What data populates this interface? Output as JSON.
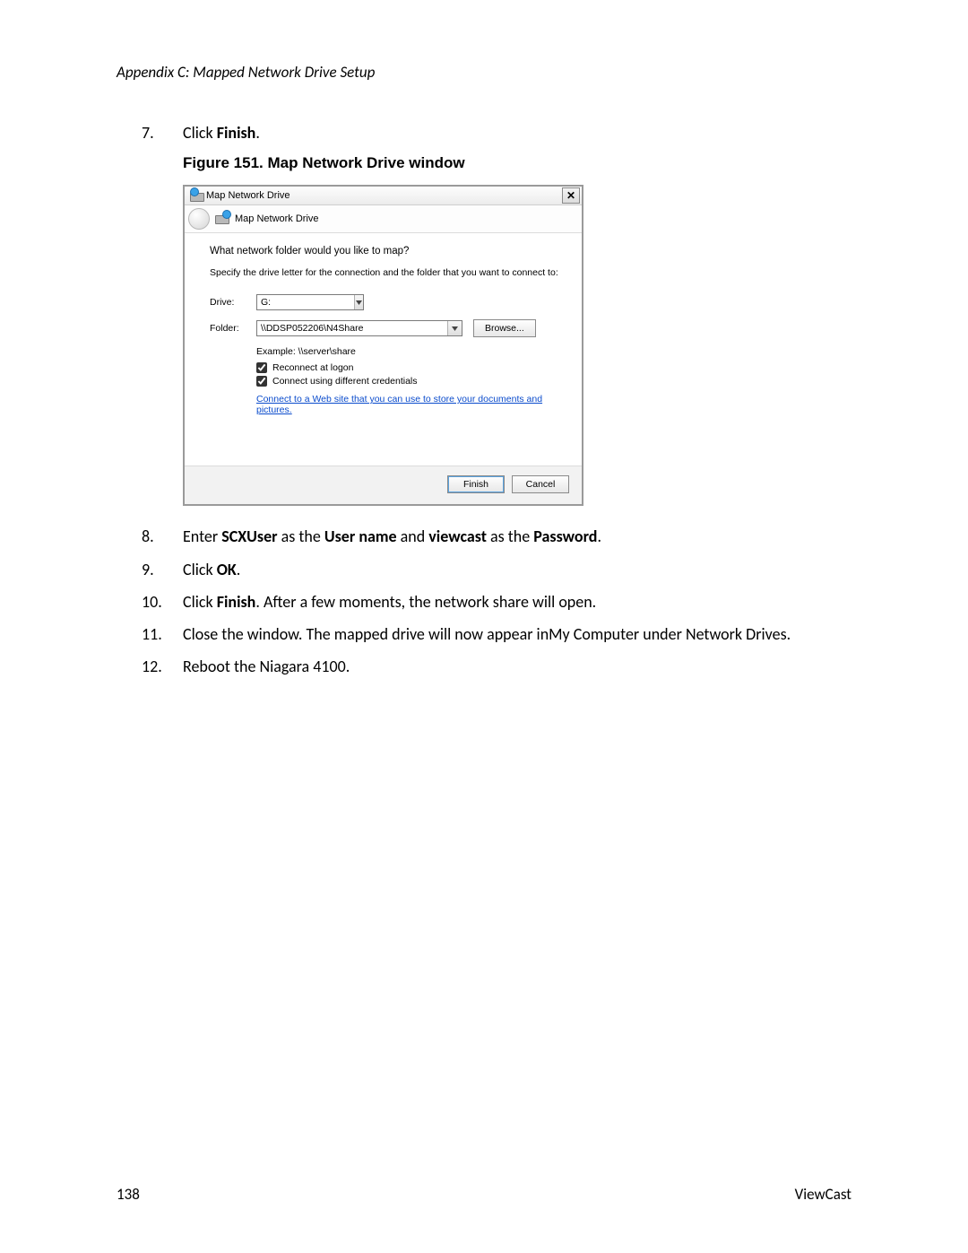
{
  "page": {
    "running_head": "Appendix C: Mapped Network Drive Setup",
    "page_number": "138",
    "brand": "ViewCast"
  },
  "steps": {
    "s7": {
      "num": "7.",
      "pre": "Click ",
      "bold": "Finish",
      "post": "."
    },
    "figure_caption": "Figure 151. Map Network Drive window",
    "s8": {
      "num": "8.",
      "t1": "Enter ",
      "b1": "SCXUser",
      "t2": " as the ",
      "b2": "User name",
      "t3": " and ",
      "b3": "viewcast",
      "t4": " as the ",
      "b4": "Password",
      "t5": "."
    },
    "s9": {
      "num": "9.",
      "pre": "Click ",
      "bold": "OK",
      "post": "."
    },
    "s10": {
      "num": "10.",
      "pre": "Click ",
      "bold": "Finish",
      "post": ". After a few moments, the network share will open."
    },
    "s11": {
      "num": "11.",
      "text": "Close the window. The mapped drive will now appear inMy Computer under Network Drives."
    },
    "s12": {
      "num": "12.",
      "text": "Reboot the Niagara 4100."
    }
  },
  "dialog": {
    "title": "Map Network Drive",
    "wizard_title": "Map Network Drive",
    "heading": "What network folder would you like to map?",
    "subheading": "Specify the drive letter for the connection and the folder that you want to connect to:",
    "drive_label": "Drive:",
    "drive_value": "G:",
    "folder_label": "Folder:",
    "folder_value": "\\\\DDSP052206\\N4Share",
    "browse": "Browse...",
    "example": "Example: \\\\server\\share",
    "cb_reconnect": "Reconnect at logon",
    "cb_credentials": "Connect using different credentials",
    "link_text": "Connect to a Web site that you can use to store your documents and pictures.",
    "finish": "Finish",
    "cancel": "Cancel",
    "close_glyph": "✕"
  }
}
